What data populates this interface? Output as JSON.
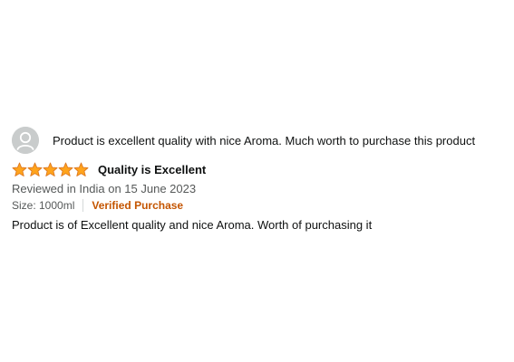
{
  "review": {
    "profile_name": "Product is excellent quality with nice Aroma. Much worth to purchase this product",
    "rating": 5,
    "rating_max": 5,
    "title": "Quality is Excellent",
    "date": "Reviewed in India on 15 June 2023",
    "variant": "Size: 1000ml",
    "verified_label": "Verified Purchase",
    "body": "Product is of Excellent quality and nice Aroma. Worth of purchasing it"
  },
  "colors": {
    "star_fill": "#ffa41c",
    "star_stroke": "#de7921",
    "verified": "#c45500",
    "avatar_bg": "#c9cccc"
  },
  "icons": {
    "avatar": "default-user-icon",
    "star": "star-icon"
  }
}
